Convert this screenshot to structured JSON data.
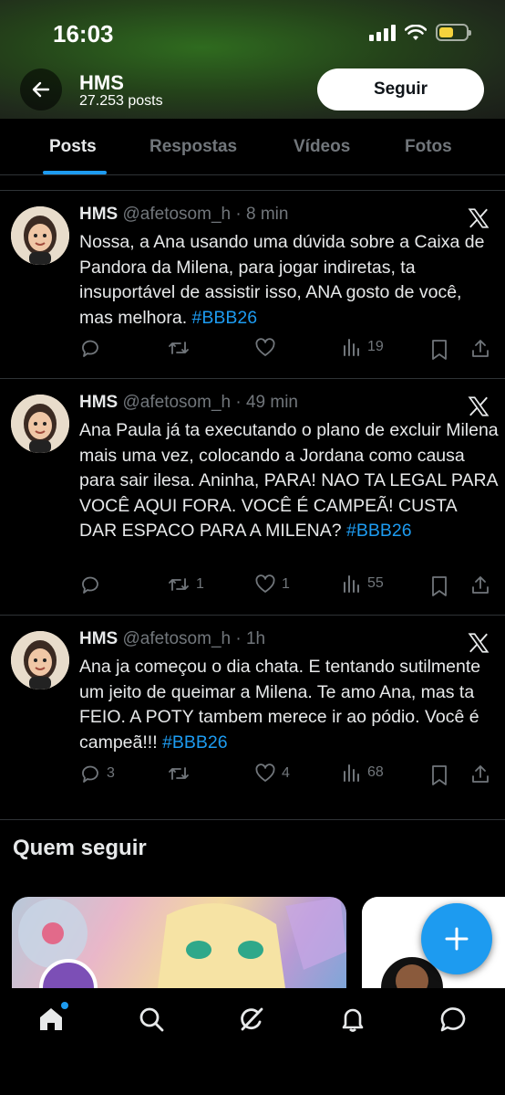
{
  "status_bar": {
    "time": "16:03"
  },
  "header": {
    "name": "HMS",
    "posts_count": "27.253 posts",
    "follow_label": "Seguir"
  },
  "tabs": [
    {
      "label": "Posts",
      "active": true
    },
    {
      "label": "Respostas",
      "active": false
    },
    {
      "label": "Vídeos",
      "active": false
    },
    {
      "label": "Fotos",
      "active": false
    }
  ],
  "tweets": [
    {
      "name": "HMS",
      "handle_time": "@afetosom_h · 8 min",
      "text": "Nossa, a Ana usando uma dúvida sobre a Caixa de Pandora da Milena, para jogar indiretas, ta insuportável de assistir isso, ANA gosto de você, mas melhora.",
      "hashtag": "#BBB26",
      "replies": "",
      "reposts": "",
      "likes": "",
      "views": "19"
    },
    {
      "name": "HMS",
      "handle_time": "@afetosom_h · 49 min",
      "text": "Ana Paula já ta executando o plano de excluir Milena mais uma vez, colocando a Jordana como  causa para sair ilesa. Aninha, PARA! NAO TA LEGAL PARA VOCÊ AQUI FORA.  VOCÊ É CAMPEÃ! CUSTA DAR ESPACO PARA A MILENA?",
      "hashtag": "#BBB26",
      "replies": "",
      "reposts": "1",
      "likes": "1",
      "views": "55"
    },
    {
      "name": "HMS",
      "handle_time": "@afetosom_h · 1h",
      "text": "Ana ja começou o dia chata. E tentando sutilmente um jeito de queimar a Milena.  Te amo Ana, mas ta FEIO. A POTY tambem merece ir ao pódio.  Você é campeã!!!",
      "hashtag": "#BBB26",
      "replies": "3",
      "reposts": "",
      "likes": "4",
      "views": "68"
    }
  ],
  "suggestions": {
    "title": "Quem seguir"
  },
  "colors": {
    "accent": "#1d9bf0",
    "text": "#e7e9ea",
    "muted": "#71767b",
    "divider": "#2f3336"
  },
  "bottom_nav": [
    "home-icon",
    "search-icon",
    "grok-icon",
    "bell-icon",
    "messages-icon"
  ]
}
